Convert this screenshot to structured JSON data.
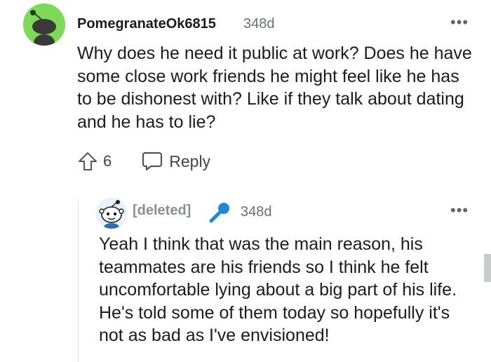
{
  "comment": {
    "username": "PomegranateOk6815",
    "age": "348d",
    "more_label": "•••",
    "body": "Why does he need it public at work? Does he have some close work friends he might feel like he has to be dishonest with? Like if they talk about dating and he has to lie?",
    "upvote_count": "6",
    "reply_label": "Reply",
    "avatar_color": "#7ed957"
  },
  "reply": {
    "username": "[deleted]",
    "age": "348d",
    "more_label": "•••",
    "body": "Yeah I think that was the main reason, his teammates are his friends so I think he felt uncomfortable lying about a big part of his life. He's told some of them today so hopefully it's not as bad as I've envisioned!",
    "badge_icon": "microphone-icon",
    "badge_color": "#1e88d8"
  }
}
